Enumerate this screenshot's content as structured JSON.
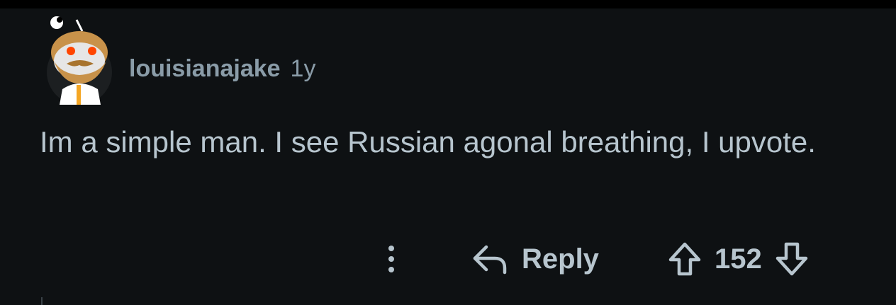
{
  "comment": {
    "username": "louisianajake",
    "age": "1y",
    "body": "Im a simple man. I see Russian agonal breathing, I upvote.",
    "avatar_icon": "snoo-avatar-icon"
  },
  "actions": {
    "more_icon": "more-vertical-icon",
    "reply_icon": "reply-arrow-icon",
    "reply_label": "Reply",
    "upvote_icon": "upvote-arrow-icon",
    "vote_count": "152",
    "downvote_icon": "downvote-arrow-icon"
  },
  "colors": {
    "background": "#0e1113",
    "text": "#b7c5ce",
    "meta": "#8a9ca8"
  }
}
